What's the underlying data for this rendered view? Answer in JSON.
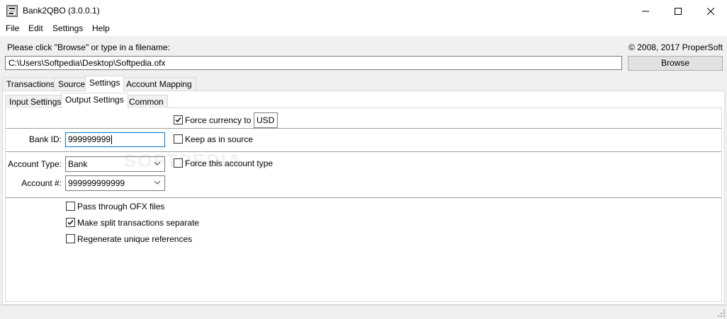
{
  "window": {
    "title": "Bank2QBO (3.0.0.1)",
    "icon_text": "Bank2QBO",
    "controls": {
      "minimize": "minimize-icon",
      "maximize": "maximize-icon",
      "close": "close-icon"
    }
  },
  "menu": {
    "items": [
      "File",
      "Edit",
      "Settings",
      "Help"
    ]
  },
  "header": {
    "prompt": "Please click \"Browse\" or type in a filename:",
    "copyright": "© 2008, 2017 ProperSoft",
    "file_path": "C:\\Users\\Softpedia\\Desktop\\Softpedia.ofx",
    "browse_label": "Browse"
  },
  "tabs": {
    "main": [
      "Transactions",
      "Source",
      "Settings",
      "Account Mapping"
    ],
    "main_active": "Settings",
    "sub": [
      "Input Settings",
      "Output Settings",
      "Common"
    ],
    "sub_active": "Output Settings"
  },
  "output_settings": {
    "force_currency": {
      "label": "Force currency to",
      "checked": true,
      "value": "USD"
    },
    "bank_id": {
      "label": "Bank ID:",
      "value": "999999999"
    },
    "keep_as_in_source": {
      "label": "Keep as in source",
      "checked": false
    },
    "account_type": {
      "label": "Account Type:",
      "value": "Bank"
    },
    "force_account_type": {
      "label": "Force this account type",
      "checked": false
    },
    "account_number": {
      "label": "Account #:",
      "value": "999999999999"
    },
    "pass_through_ofx": {
      "label": "Pass through OFX files",
      "checked": false
    },
    "split_transactions": {
      "label": "Make split transactions separate",
      "checked": true
    },
    "regenerate_refs": {
      "label": "Regenerate unique references",
      "checked": false
    }
  },
  "watermark": "SOFTPEDIA",
  "colors": {
    "accent_border": "#0078d7",
    "window_bg": "#f0f0f0"
  }
}
